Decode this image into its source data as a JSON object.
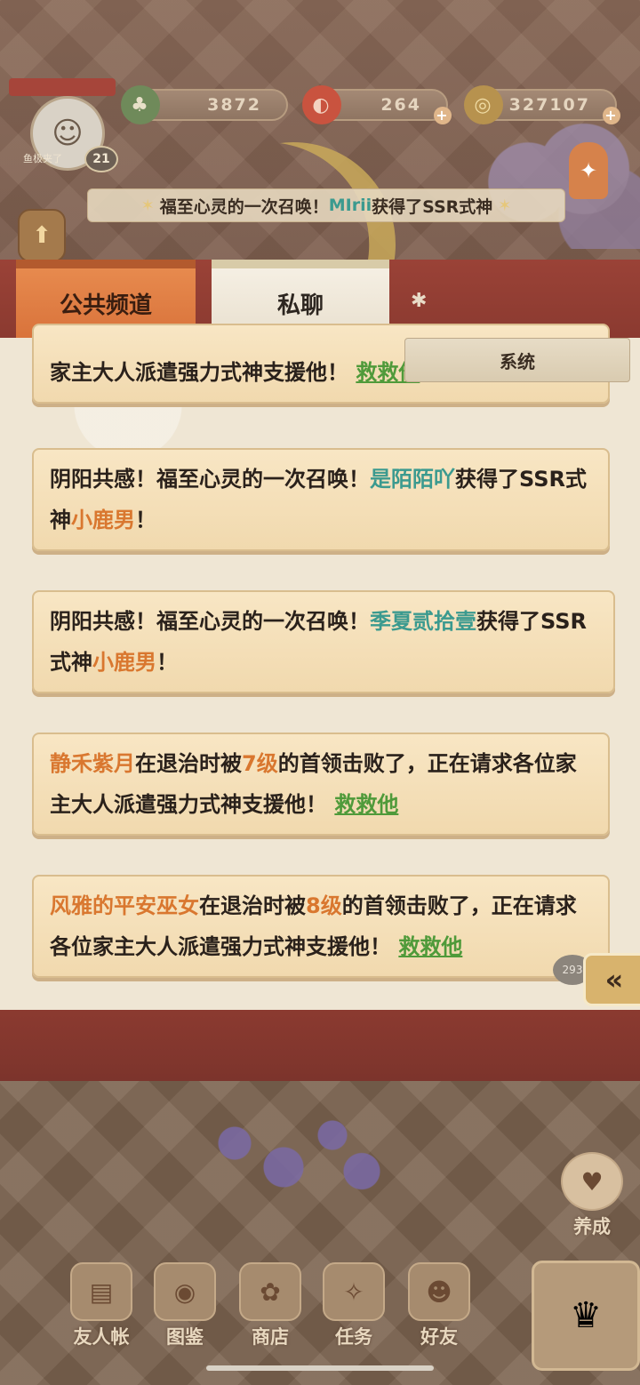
{
  "resources": {
    "jade": "3872",
    "magatama": "264",
    "coins": "327107"
  },
  "player": {
    "name": "鱼极夹了",
    "level": "21"
  },
  "announcement": {
    "prefix": "福至心灵的一次召唤！",
    "player": "MIrii",
    "suffix": "获得了SSR式神"
  },
  "tabs": {
    "public": "公共频道",
    "private": "私聊",
    "system": "系统"
  },
  "messages": [
    {
      "text1": "家主大人派遣强力式神支援他！",
      "link": "救救他"
    },
    {
      "prefix": "阴阳共感！福至心灵的一次召唤！",
      "player": "是陌陌吖",
      "mid": "获得了SSR式神",
      "shikigami": "小鹿男",
      "end": "！"
    },
    {
      "prefix": "阴阳共感！福至心灵的一次召唤！",
      "player": "季夏贰拾壹",
      "mid": "获得了SSR式神",
      "shikigami": "小鹿男",
      "end": "！"
    },
    {
      "player": "静禾紫月",
      "t1": "在退治时被",
      "level": "7级",
      "t2": "的首领击败了，正在请求各位家主大人派遣强力式神支援他！",
      "link": "救救他"
    },
    {
      "player": "风雅的平安巫女",
      "t1": "在退治时被",
      "level": "8级",
      "t2": "的首领击败了，正在请求各位家主大人派遣强力式神支援他！",
      "link": "救救他"
    }
  ],
  "unread_count": "293",
  "nav": {
    "yangcheng": "养成",
    "friends_book": "友人帐",
    "illustrations": "图鉴",
    "shop": "商店",
    "tasks": "任务",
    "buddies": "好友"
  },
  "colors": {
    "player_name": "#d9772f",
    "ssr_player": "#3b9a8f",
    "help_link": "#4f9a3a",
    "tab_active": "#e78a4e",
    "panel_red": "#8b3a30"
  }
}
